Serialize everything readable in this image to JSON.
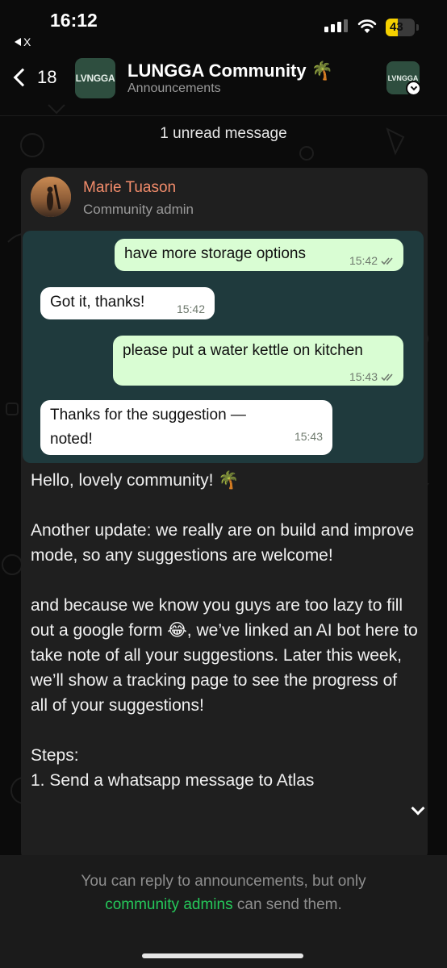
{
  "status_bar": {
    "time": "16:12",
    "back_app_label": "X",
    "battery_level": "43",
    "battery_fraction": 0.43,
    "signal_icon": "cellular-signal-icon",
    "wifi_icon": "wifi-icon"
  },
  "header": {
    "back_count": "18",
    "group_logo_text": "LVNGGA",
    "title": "LUNGGA Community 🌴",
    "subtitle": "Announcements",
    "avatar_text": "LVNGGA"
  },
  "unread_label": "1 unread message",
  "message": {
    "sender_name": "Marie Tuason",
    "sender_role": "Community admin",
    "embedded_chat": [
      {
        "direction": "out",
        "text": "have more storage options",
        "time": "15:42",
        "read": true
      },
      {
        "direction": "in",
        "text": "Got it, thanks!",
        "time": "15:42"
      },
      {
        "direction": "out",
        "text": "please put a water kettle on kitchen",
        "time": "15:43",
        "read": true
      },
      {
        "direction": "in",
        "text": "Thanks for the suggestion — noted!",
        "time": "15:43"
      }
    ],
    "paragraphs": [
      "Hello, lovely community! 🌴",
      "Another update: we really are on build and improve mode, so any suggestions are welcome!",
      "and because we know you guys are too lazy to fill out a google form 😂, we’ve linked an AI bot here to take note of all your suggestions. Later this week, we’ll show a tracking page to see the progress of all of your suggestions!",
      "Steps:",
      "1. Send a whatsapp message to Atlas"
    ]
  },
  "footer": {
    "text_before": "You can reply to announcements, but only",
    "link": "community admins",
    "text_after": "can send them."
  },
  "colors": {
    "sender_name": "#f28c6b",
    "outgoing_bubble": "#d9fdd3",
    "link_green": "#25c85a",
    "battery_yellow": "#f5d000"
  }
}
